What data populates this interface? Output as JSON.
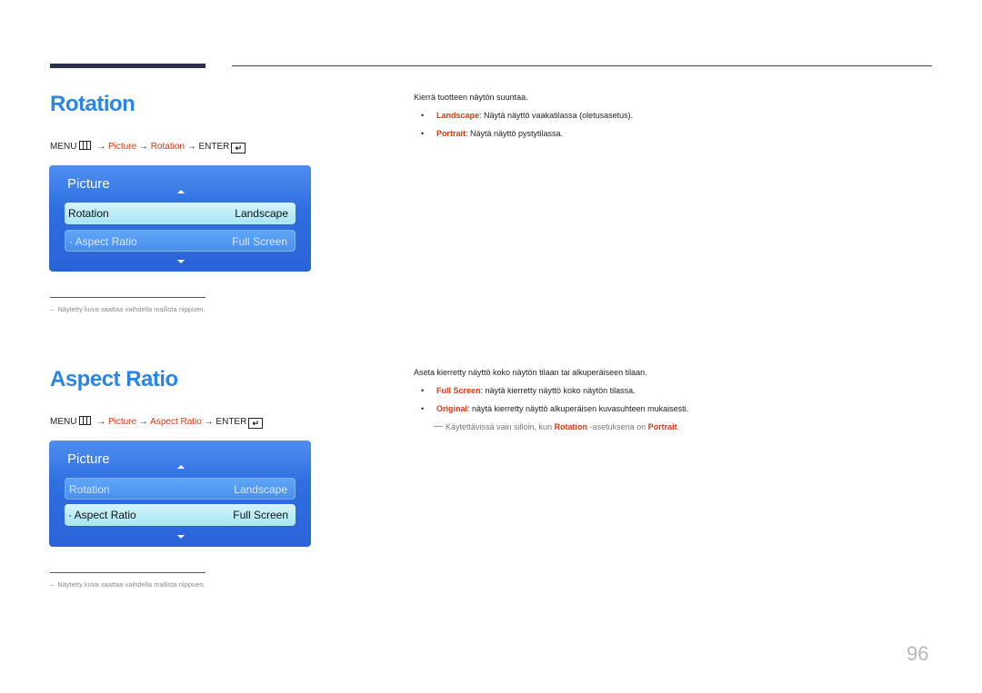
{
  "rotation_section": {
    "title": "Rotation",
    "path": {
      "menu": "MENU",
      "arrow": "→",
      "picture": "Picture",
      "item": "Rotation",
      "enter": "ENTER",
      "enter_glyph": "↵"
    },
    "panel": {
      "title": "Picture",
      "rows": [
        {
          "label": "Rotation",
          "value": "Landscape",
          "selected": true
        },
        {
          "label": "· Aspect Ratio",
          "value": "Full Screen",
          "selected": false
        }
      ]
    },
    "footnote": "Näytetty kuva saattaa vaihdella mallista riippuen.",
    "footnote_dash": "–",
    "description": "Kierrä tuotteen näytön suuntaa.",
    "bullets": [
      {
        "term": "Landscape",
        "text": ": Näytä näyttö vaakatilassa (oletusasetus)."
      },
      {
        "term": "Portrait",
        "text": ": Näytä näyttö pystytilassa."
      }
    ]
  },
  "aspect_section": {
    "title": "Aspect Ratio",
    "path": {
      "menu": "MENU",
      "arrow": "→",
      "picture": "Picture",
      "item": "Aspect Ratio",
      "enter": "ENTER",
      "enter_glyph": "↵"
    },
    "panel": {
      "title": "Picture",
      "rows": [
        {
          "label": "Rotation",
          "value": "Landscape",
          "selected": false
        },
        {
          "label": "· Aspect Ratio",
          "value": "Full Screen",
          "selected": true
        }
      ]
    },
    "footnote": "Näytetty kuva saattaa vaihdella mallista riippuen.",
    "footnote_dash": "–",
    "description": "Aseta kierretty näyttö koko näytön tilaan tai alkuperäiseen tilaan.",
    "bullets": [
      {
        "term": "Full Screen",
        "text": ": näytä kierretty näyttö koko näytön tilassa."
      },
      {
        "term": "Original",
        "text": ": näytä kierretty näyttö alkuperäisen kuvasuhteen mukaisesti."
      }
    ],
    "note": {
      "pre": "Käytettävissä vain silloin, kun ",
      "term1": "Rotation",
      "mid": " -asetuksena on ",
      "term2": "Portrait",
      "post": "."
    }
  },
  "bullet_char": "•",
  "page_number": "96",
  "colors": {
    "heading": "#2a85e8",
    "highlight": "#d43a12",
    "panel": "#2f6fe0"
  }
}
